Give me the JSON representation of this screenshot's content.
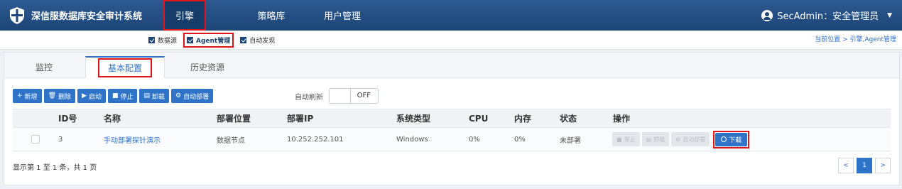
{
  "app": {
    "title": "深信服数据库安全审计系统",
    "colors": {
      "nav_bg": "#1d4577",
      "accent": "#2f74c9",
      "highlight": "#e0141b"
    }
  },
  "topnav": {
    "items": [
      {
        "label": "引擎",
        "active": true
      },
      {
        "label": "策略库",
        "active": false
      },
      {
        "label": "用户管理",
        "active": false
      }
    ]
  },
  "user": {
    "label": "SecAdmin：安全管理员",
    "icon": "user-circle-icon"
  },
  "subnav": {
    "items": [
      {
        "label": "数据源",
        "icon": "square-icon"
      },
      {
        "label": "Agent管理",
        "icon": "checkbox-icon",
        "active": true
      },
      {
        "label": "自动发现",
        "icon": "checkbox-icon"
      }
    ]
  },
  "breadcrumb": "当前位置 > 引擎,Agent管理",
  "tabs": [
    {
      "label": "监控"
    },
    {
      "label": "基本配置",
      "active": true
    },
    {
      "label": "历史资源"
    }
  ],
  "toolbar": {
    "buttons": [
      {
        "label": "新增",
        "icon": "+"
      },
      {
        "label": "删除",
        "icon": "🗑"
      },
      {
        "label": "启动",
        "icon": "▶"
      },
      {
        "label": "停止",
        "icon": "■"
      },
      {
        "label": "卸载",
        "icon": "▤"
      },
      {
        "label": "自动部署",
        "icon": "⚙"
      }
    ],
    "auto_refresh_label": "自动刷新",
    "toggle_state": "OFF"
  },
  "table": {
    "columns": [
      "ID号",
      "名称",
      "部署位置",
      "部署IP",
      "系统类型",
      "CPU",
      "内存",
      "状态",
      "操作"
    ],
    "rows": [
      {
        "id": "3",
        "name": "手动部署探针演示",
        "location": "数据节点",
        "ip": "10.252.252.101",
        "os": "Windows",
        "cpu": "0%",
        "mem": "0%",
        "status": "未部署",
        "actions": {
          "stop": "停止",
          "uninstall": "卸载",
          "auto_deploy": "自动部署",
          "download": "下载"
        }
      }
    ]
  },
  "footer": {
    "info": "显示第 1 至 1 条，共 1 页",
    "pager": {
      "prev": "<",
      "current": "1",
      "next": ">"
    }
  }
}
